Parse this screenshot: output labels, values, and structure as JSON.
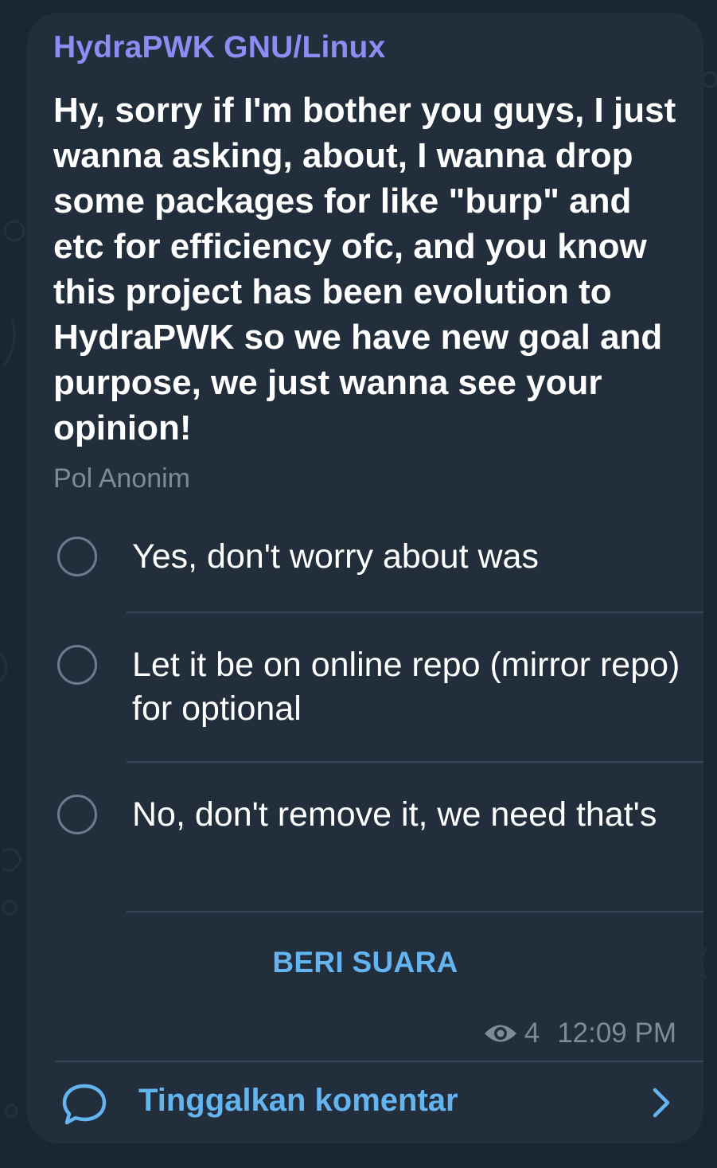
{
  "colors": {
    "background": "#1a2633",
    "bubble": "#222e3b",
    "sender": "#8c8cf2",
    "accent": "#64b4f0",
    "muted": "#7d8b99",
    "text": "#ffffff"
  },
  "message": {
    "sender": "HydraPWK GNU/Linux",
    "question": "Hy, sorry if I'm bother you guys, I just wanna asking, about, I wanna drop some packages for like \"burp\" and etc for efficiency ofc, and you know this project has been evolution to HydraPWK so we have new goal and purpose, we just wanna see your opinion!",
    "poll_type": "Pol Anonim",
    "options": [
      {
        "label": "Yes, don't worry about was"
      },
      {
        "label": "Let it be on online repo (mirror repo) for optional"
      },
      {
        "label": "No, don't remove it, we need that's"
      }
    ],
    "vote_label": "BERI SUARA",
    "views": "4",
    "time": "12:09 PM",
    "view_icon": "eye-icon"
  },
  "comments": {
    "label": "Tinggalkan komentar",
    "icon": "comment-bubble-icon",
    "arrow_icon": "chevron-right-icon"
  }
}
